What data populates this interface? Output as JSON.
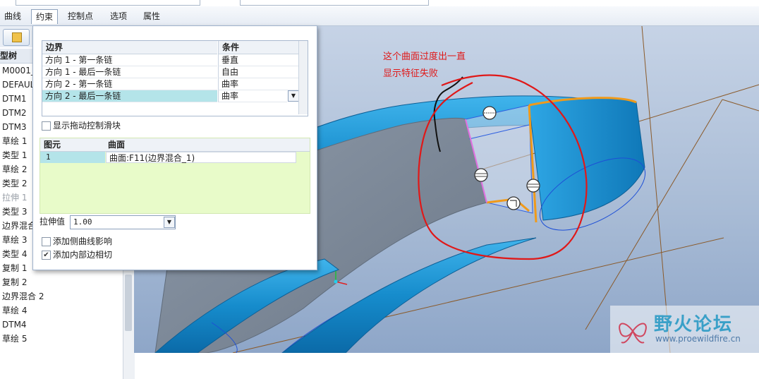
{
  "tabs": [
    "曲线",
    "约束",
    "控制点",
    "选项",
    "属性"
  ],
  "active_tab": "约束",
  "tree": {
    "header": "型树",
    "items": [
      "M0001_",
      "DEFAUL",
      "DTM1",
      "DTM2",
      "DTM3",
      "草绘 1",
      "类型 1",
      "草绘 2",
      "类型 2",
      "拉伸 1",
      "类型 3",
      "边界混合",
      "草绘 3",
      "类型 4",
      "复制 1",
      "复制 2",
      "边界混合 2",
      "草绘 4",
      "DTM4",
      "草绘 5"
    ],
    "dim_items": [
      "拉伸 1"
    ]
  },
  "boundary_table": {
    "headers": [
      "边界",
      "条件"
    ],
    "rows": [
      {
        "boundary": "方向 1 - 第一条链",
        "condition": "垂直"
      },
      {
        "boundary": "方向 1 - 最后一条链",
        "condition": "自由"
      },
      {
        "boundary": "方向 2 - 第一条链",
        "condition": "曲率"
      },
      {
        "boundary": "方向 2 - 最后一条链",
        "condition": "曲率"
      }
    ]
  },
  "show_drag_slider_label": "显示拖动控制滑块",
  "element_table": {
    "headers": [
      "图元",
      "曲面"
    ],
    "rows": [
      {
        "element": "1",
        "surface": "曲面:F11(边界混合_1)"
      }
    ]
  },
  "stretch_label": "拉伸值",
  "stretch_value": "1.00",
  "side_curve_label": "添加侧曲线影响",
  "side_curve_checked": false,
  "inner_edge_label": "添加内部边相切",
  "inner_edge_checked": true,
  "annotation": {
    "line1": "这个曲面过度出一直",
    "line2": "显示特征失败"
  },
  "watermark": {
    "title": "野火论坛",
    "url": "www.proewildfire.cn"
  },
  "colors": {
    "annotation": "#e01818",
    "surface": "#1e8fd0",
    "selected_row": "#b4e4e9",
    "table_bg": "#e8fbc9"
  }
}
